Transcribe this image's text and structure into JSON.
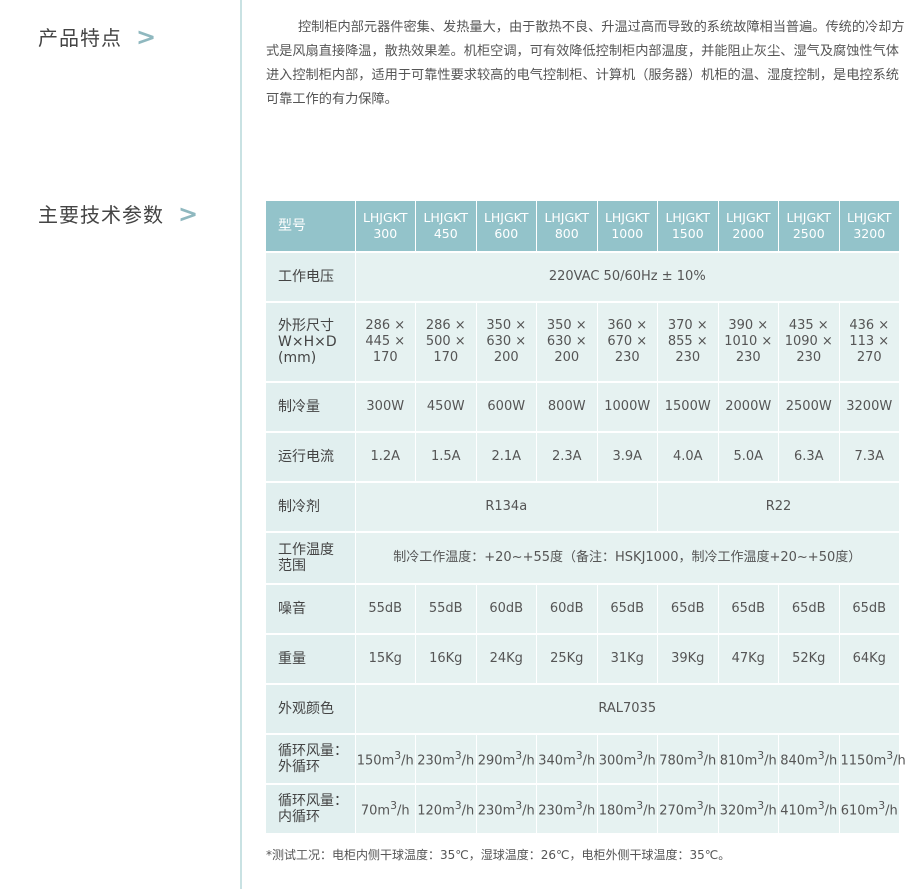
{
  "features": {
    "title": "产品特点",
    "arrow": ">",
    "text": "控制柜内部元器件密集、发热量大，由于散热不良、升温过高而导致的系统故障相当普遍。传统的冷却方式是风扇直接降温，散热效果差。机柜空调，可有效降低控制柜内部温度，并能阻止灰尘、湿气及腐蚀性气体进入控制柜内部，适用于可靠性要求较高的电气控制柜、计算机（服务器）机柜的温、湿度控制，是电控系统可靠工作的有力保障。"
  },
  "specs": {
    "title": "主要技术参数",
    "arrow": ">",
    "header_label": "型号",
    "models": [
      {
        "line1": "LHJGKT",
        "line2": "300"
      },
      {
        "line1": "LHJGKT",
        "line2": "450"
      },
      {
        "line1": "LHJGKT",
        "line2": "600"
      },
      {
        "line1": "LHJGKT",
        "line2": "800"
      },
      {
        "line1": "LHJGKT",
        "line2": "1000"
      },
      {
        "line1": "LHJGKT",
        "line2": "1500"
      },
      {
        "line1": "LHJGKT",
        "line2": "2000"
      },
      {
        "line1": "LHJGKT",
        "line2": "2500"
      },
      {
        "line1": "LHJGKT",
        "line2": "3200"
      }
    ],
    "voltage": {
      "label": "工作电压",
      "value": "220VAC  50/60Hz  ± 10%"
    },
    "dimensions": {
      "label1": "外形尺寸",
      "label2": "W×H×D",
      "label3": "(mm)",
      "values": [
        [
          "286 ×",
          "445 ×",
          "170"
        ],
        [
          "286 ×",
          "500 ×",
          "170"
        ],
        [
          "350 ×",
          "630 ×",
          "200"
        ],
        [
          "350 ×",
          "630 ×",
          "200"
        ],
        [
          "360 ×",
          "670 ×",
          "230"
        ],
        [
          "370 ×",
          "855 ×",
          "230"
        ],
        [
          "390 ×",
          "1010 ×",
          "230"
        ],
        [
          "435 ×",
          "1090 ×",
          "230"
        ],
        [
          "436 ×",
          "113 ×",
          "270"
        ]
      ]
    },
    "cooling": {
      "label": "制冷量",
      "values": [
        "300W",
        "450W",
        "600W",
        "800W",
        "1000W",
        "1500W",
        "2000W",
        "2500W",
        "3200W"
      ]
    },
    "current": {
      "label": "运行电流",
      "values": [
        "1.2A",
        "1.5A",
        "2.1A",
        "2.3A",
        "3.9A",
        "4.0A",
        "5.0A",
        "6.3A",
        "7.3A"
      ]
    },
    "refrigerant": {
      "label": "制冷剂",
      "value_a": "R134a",
      "value_b": "R22"
    },
    "temperature": {
      "label1": "工作温度",
      "label2": "范围",
      "value": "制冷工作温度：+20~+55度（备注：HSKJ1000，制冷工作温度+20~+50度）"
    },
    "noise": {
      "label": "噪音",
      "values": [
        "55dB",
        "55dB",
        "60dB",
        "60dB",
        "65dB",
        "65dB",
        "65dB",
        "65dB",
        "65dB"
      ]
    },
    "weight": {
      "label": "重量",
      "values": [
        "15Kg",
        "16Kg",
        "24Kg",
        "25Kg",
        "31Kg",
        "39Kg",
        "47Kg",
        "52Kg",
        "64Kg"
      ]
    },
    "color": {
      "label": "外观颜色",
      "value": "RAL7035"
    },
    "flow_out": {
      "label1": "循环风量：",
      "label2": "外循环",
      "unit": "3",
      "suffix": "/h",
      "values": [
        "150m",
        "230m",
        "290m",
        "340m",
        "300m",
        "780m",
        "810m",
        "840m",
        "1150m"
      ]
    },
    "flow_in": {
      "label1": "循环风量：",
      "label2": "内循环",
      "unit": "3",
      "suffix": "/h",
      "values": [
        "70m",
        "120m",
        "230m",
        "230m",
        "180m",
        "270m",
        "320m",
        "410m",
        "610m"
      ]
    }
  },
  "footnote": "*测试工况：电柜内侧干球温度：35℃，湿球温度：26℃，电柜外侧干球温度：35℃。",
  "colors": {
    "header_bg": "#93c3ca",
    "cell_bg": "#e6f2f1",
    "divider": "#c9e2e3",
    "arrow": "#8fb8bf"
  }
}
